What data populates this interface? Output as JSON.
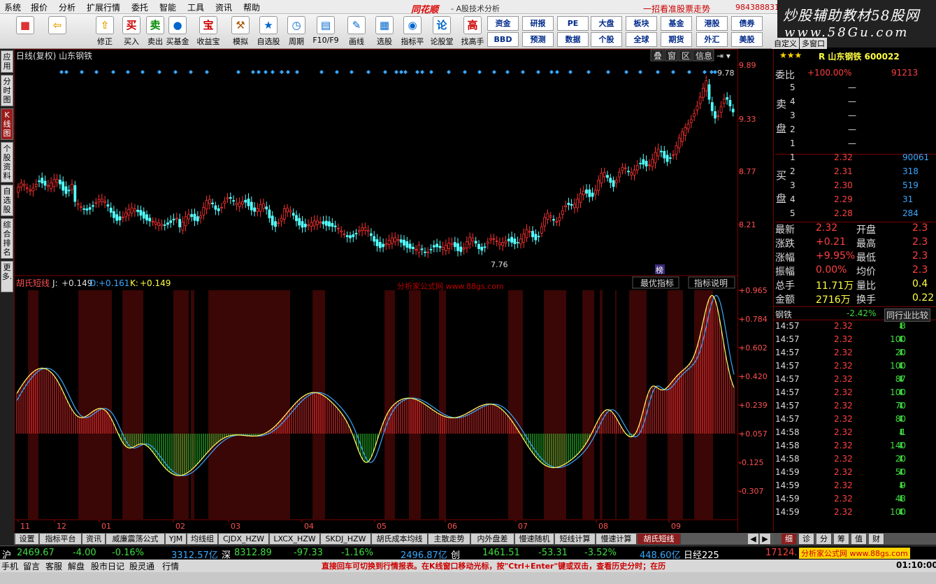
{
  "menu": [
    "系统",
    "报价",
    "分析",
    "扩展行情",
    "委托",
    "智能",
    "工具",
    "资讯",
    "帮助"
  ],
  "brand": "同花顺",
  "subtitle": "- A股技术分析",
  "promo": "一招看准股票走势",
  "phone": "984388831",
  "watermark": {
    "line1": "炒股辅助教材58股网",
    "line2": "www.58Gu.com"
  },
  "toolbar": {
    "big": [
      {
        "label": "",
        "icon": "■",
        "color": "#d33"
      },
      {
        "label": "",
        "icon": "⇦",
        "color": "#e8a000"
      },
      {
        "label": "修正",
        "icon": "⇧",
        "color": "#e8a000"
      },
      {
        "label": "买入",
        "icon": "买",
        "color": "#c00"
      },
      {
        "label": "卖出",
        "icon": "卖",
        "color": "#080"
      },
      {
        "label": "买基金",
        "icon": "●",
        "color": "#06c"
      },
      {
        "label": "收益宝",
        "icon": "宝",
        "color": "#c00"
      },
      {
        "label": "模拟",
        "icon": "⚒",
        "color": "#a50"
      },
      {
        "label": "自选股",
        "icon": "★",
        "color": "#06c"
      },
      {
        "label": "周期",
        "icon": "◷",
        "color": "#06c"
      },
      {
        "label": "F10/F9",
        "icon": "▤",
        "color": "#06c"
      },
      {
        "label": "画线",
        "icon": "✎",
        "color": "#06c"
      },
      {
        "label": "选股",
        "icon": "▦",
        "color": "#06c"
      },
      {
        "label": "指标平台",
        "icon": "◉",
        "color": "#06c"
      },
      {
        "label": "论股堂",
        "icon": "论",
        "color": "#06c"
      },
      {
        "label": "找高手",
        "icon": "高",
        "color": "#c00"
      }
    ],
    "small": [
      "资金",
      "研报",
      "PE",
      "大盘",
      "板块",
      "基金",
      "港股",
      "债券",
      "BBD",
      "预测",
      "",
      "数据",
      "个股",
      "全球",
      "期货",
      "外汇",
      "美股"
    ]
  },
  "sidebar": [
    "应用",
    "分时图",
    "K线图",
    "个股资料",
    "自选股",
    "综合排名",
    "更多."
  ],
  "chart": {
    "header": "日线(复权) 山东钢铁",
    "top_buttons": [
      "叠",
      "窗",
      "区",
      "信息"
    ],
    "price_labels": [
      "9.89",
      "9.33",
      "8.77",
      "8.21"
    ],
    "high_label": "9.78",
    "low_label": "7.76",
    "mark_label": "榜",
    "ind_name": "胡氏短线",
    "ind_j_label": "J:",
    "ind_j": "+0.149",
    "ind_d_label": "D:",
    "ind_d": "+0.161",
    "ind_k_label": "K:",
    "ind_k": "+0.149",
    "ind_watermark": "分析家公式网 www.88gs.com",
    "ind_buttons": [
      "最优指标",
      "指标说明"
    ],
    "ind_labels": [
      "+0.965",
      "+0.784",
      "+0.602",
      "+0.420",
      "+0.239",
      "+0.057",
      "-0.125",
      "-0.307"
    ],
    "date_labels": [
      "11",
      "12",
      "01",
      "02",
      "03",
      "04",
      "05",
      "06",
      "07",
      "08",
      "09"
    ]
  },
  "panel": {
    "stars": "★★★",
    "code": "R 山东钢铁 600022",
    "weibi_label": "委比",
    "weibi": "+100.00%",
    "weicha": "91213",
    "sell_label": [
      "卖",
      "盘"
    ],
    "buy_label": [
      "买",
      "盘"
    ],
    "sells": [
      {
        "n": "5",
        "p": "—",
        "v": ""
      },
      {
        "n": "4",
        "p": "—",
        "v": ""
      },
      {
        "n": "3",
        "p": "—",
        "v": ""
      },
      {
        "n": "2",
        "p": "—",
        "v": ""
      },
      {
        "n": "1",
        "p": "—",
        "v": ""
      }
    ],
    "buys": [
      {
        "n": "1",
        "p": "2.32",
        "v": "90061"
      },
      {
        "n": "2",
        "p": "2.31",
        "v": "318"
      },
      {
        "n": "3",
        "p": "2.30",
        "v": "519"
      },
      {
        "n": "4",
        "p": "2.29",
        "v": "31"
      },
      {
        "n": "5",
        "p": "2.28",
        "v": "284"
      }
    ],
    "stats": [
      {
        "l": "最新",
        "v": "2.32",
        "l2": "开盘",
        "v2": "2.3"
      },
      {
        "l": "涨跌",
        "v": "+0.21",
        "l2": "最高",
        "v2": "2.3"
      },
      {
        "l": "涨幅",
        "v": "+9.95%",
        "l2": "最低",
        "v2": "2.3"
      },
      {
        "l": "振幅",
        "v": "0.00%",
        "l2": "均价",
        "v2": "2.3"
      },
      {
        "l": "总手",
        "v": "11.71万",
        "l2": "量比",
        "v2": "0.4"
      },
      {
        "l": "金额",
        "v": "2716万",
        "l2": "换手",
        "v2": "0.22"
      }
    ],
    "industry": "钢铁",
    "industry_pct": "-2.42%",
    "industry_btn": "同行业比较",
    "ticks": [
      {
        "t": "14:57",
        "p": "2.32",
        "v": "3"
      },
      {
        "t": "14:57",
        "p": "2.32",
        "v": "100"
      },
      {
        "t": "14:57",
        "p": "2.32",
        "v": "20"
      },
      {
        "t": "14:57",
        "p": "2.32",
        "v": "100"
      },
      {
        "t": "14:57",
        "p": "2.32",
        "v": "87"
      },
      {
        "t": "14:57",
        "p": "2.32",
        "v": "100"
      },
      {
        "t": "14:57",
        "p": "2.32",
        "v": "70"
      },
      {
        "t": "14:57",
        "p": "2.32",
        "v": "80"
      },
      {
        "t": "14:58",
        "p": "2.32",
        "v": "1"
      },
      {
        "t": "14:58",
        "p": "2.32",
        "v": "140"
      },
      {
        "t": "14:58",
        "p": "2.32",
        "v": "20"
      },
      {
        "t": "14:59",
        "p": "2.32",
        "v": "50"
      },
      {
        "t": "14:59",
        "p": "2.32",
        "v": "9"
      },
      {
        "t": "14:59",
        "p": "2.32",
        "v": "43"
      },
      {
        "t": "14:59",
        "p": "2.32",
        "v": "100"
      }
    ],
    "top_tabs": [
      "自定义",
      "多窗口"
    ]
  },
  "bottom_tabs": [
    "设置",
    "指标平台",
    "资讯",
    "威廉震荡公式",
    "YJM",
    "均线组",
    "CJDX_HZW",
    "LXCX_HZW",
    "SKDJ_HZW",
    "胡氏成本均线",
    "主散走势",
    "内外盘差",
    "慢速随机",
    "短线计算",
    "慢速计算",
    "胡氏短线"
  ],
  "right_tabs": [
    "细",
    "诊",
    "分",
    "筹",
    "值",
    "财"
  ],
  "status": {
    "sh_label": "沪",
    "sh": "2469.67",
    "sh_chg": "-4.00",
    "sh_pct": "-0.16%",
    "sh_amt": "3312.57亿",
    "sz_label": "深",
    "sz": "8312.89",
    "sz_chg": "-97.33",
    "sz_pct": "-1.16%",
    "sz_amt": "2496.87亿",
    "cy_label": "创",
    "cy": "1461.51",
    "cy_chg": "-53.31",
    "cy_pct": "-3.52%",
    "cy_amt": "448.60亿",
    "nk_label": "日经225",
    "nk": "17124.",
    "ad": "分析家公式网 www.88gs.com"
  },
  "status2": {
    "items": [
      "手机",
      "留言",
      "客服",
      "解盘",
      "股市日记",
      "股灵通",
      "行情"
    ],
    "tip": "直接回车可切换到行情报表。在K线窗口移动光标，按\"Ctrl+Enter\"键或双击，查看历史分时；在历",
    "time": "01:10:00"
  }
}
